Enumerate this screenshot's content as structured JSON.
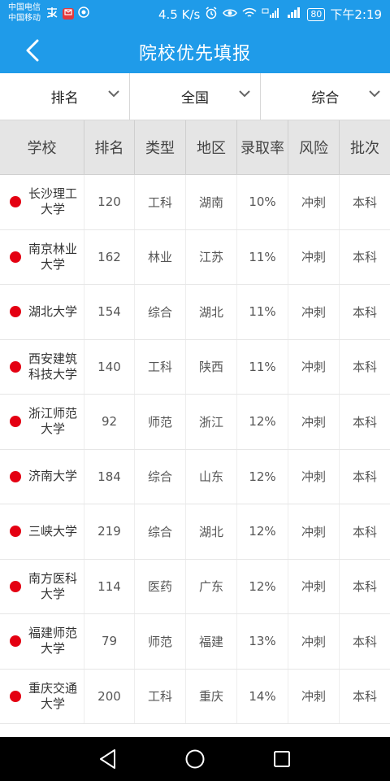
{
  "status": {
    "carrier1": "中国电信",
    "carrier2": "中国移动",
    "speed": "4.5 K/s",
    "battery": "80",
    "time": "下午2:19"
  },
  "header": {
    "title": "院校优先填报"
  },
  "filters": [
    {
      "label": "排名"
    },
    {
      "label": "全国"
    },
    {
      "label": "综合"
    }
  ],
  "table": {
    "columns": [
      "学校",
      "排名",
      "类型",
      "地区",
      "录取率",
      "风险",
      "批次"
    ],
    "rows": [
      {
        "school": "长沙理工大学",
        "rank": "120",
        "type": "工科",
        "region": "湖南",
        "rate": "10%",
        "risk": "冲刺",
        "batch": "本科"
      },
      {
        "school": "南京林业大学",
        "rank": "162",
        "type": "林业",
        "region": "江苏",
        "rate": "11%",
        "risk": "冲刺",
        "batch": "本科"
      },
      {
        "school": "湖北大学",
        "rank": "154",
        "type": "综合",
        "region": "湖北",
        "rate": "11%",
        "risk": "冲刺",
        "batch": "本科"
      },
      {
        "school": "西安建筑科技大学",
        "rank": "140",
        "type": "工科",
        "region": "陕西",
        "rate": "11%",
        "risk": "冲刺",
        "batch": "本科"
      },
      {
        "school": "浙江师范大学",
        "rank": "92",
        "type": "师范",
        "region": "浙江",
        "rate": "12%",
        "risk": "冲刺",
        "batch": "本科"
      },
      {
        "school": "济南大学",
        "rank": "184",
        "type": "综合",
        "region": "山东",
        "rate": "12%",
        "risk": "冲刺",
        "batch": "本科"
      },
      {
        "school": "三峡大学",
        "rank": "219",
        "type": "综合",
        "region": "湖北",
        "rate": "12%",
        "risk": "冲刺",
        "batch": "本科"
      },
      {
        "school": "南方医科大学",
        "rank": "114",
        "type": "医药",
        "region": "广东",
        "rate": "12%",
        "risk": "冲刺",
        "batch": "本科"
      },
      {
        "school": "福建师范大学",
        "rank": "79",
        "type": "师范",
        "region": "福建",
        "rate": "13%",
        "risk": "冲刺",
        "batch": "本科"
      },
      {
        "school": "重庆交通大学",
        "rank": "200",
        "type": "工科",
        "region": "重庆",
        "rate": "14%",
        "risk": "冲刺",
        "batch": "本科"
      }
    ]
  },
  "colors": {
    "header": "#1f9be9",
    "risk_dot": "#e40012"
  },
  "icons": {
    "back": "chevron-left-icon",
    "dropdown": "chevron-down-icon",
    "nav_back": "triangle-back-icon",
    "nav_home": "circle-home-icon",
    "nav_recent": "square-recent-icon"
  }
}
